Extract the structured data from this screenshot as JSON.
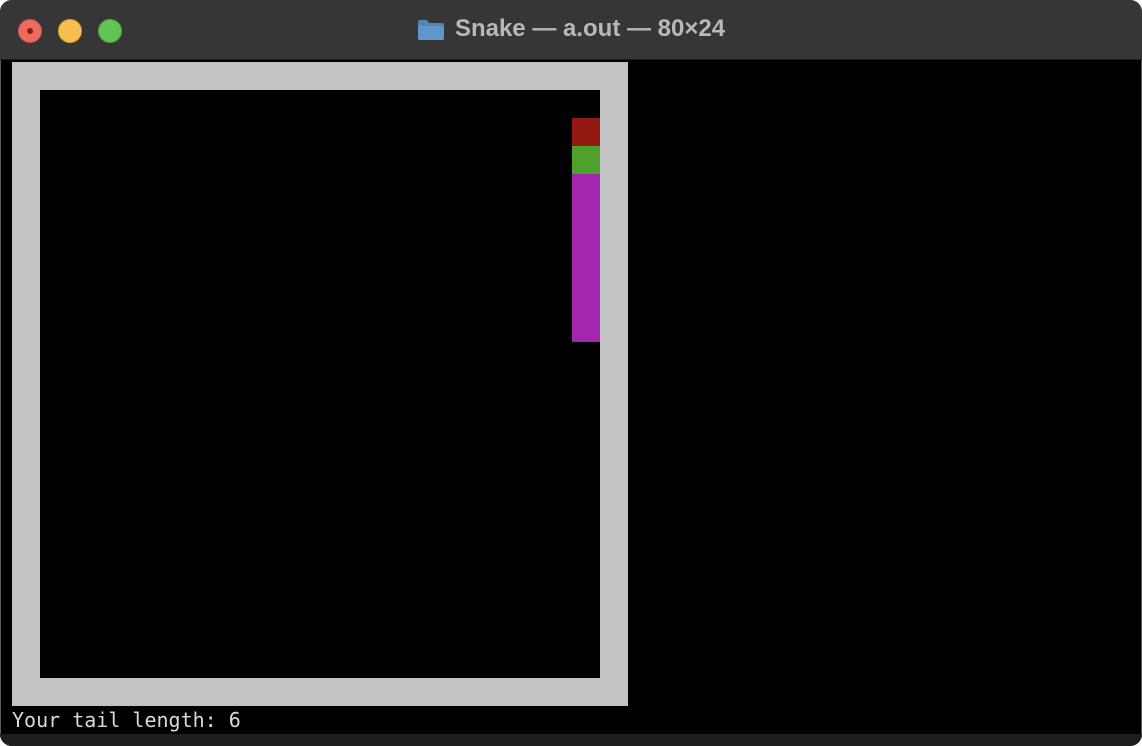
{
  "window": {
    "title": "Snake — a.out — 80×24",
    "icon": "folder-icon"
  },
  "colors": {
    "wall": "#c3c3c3",
    "apple": "#921a12",
    "snake_head": "#4ea22c",
    "snake_body": "#a425ae"
  },
  "game": {
    "apple": {
      "col": 19,
      "row": 1
    },
    "snake": {
      "head": {
        "col": 19,
        "row": 2
      },
      "tail": [
        {
          "col": 19,
          "row": 3
        },
        {
          "col": 19,
          "row": 4
        },
        {
          "col": 19,
          "row": 5
        },
        {
          "col": 19,
          "row": 6
        },
        {
          "col": 19,
          "row": 7
        },
        {
          "col": 19,
          "row": 8
        }
      ]
    }
  },
  "status": {
    "text": "Your tail length: 6"
  }
}
